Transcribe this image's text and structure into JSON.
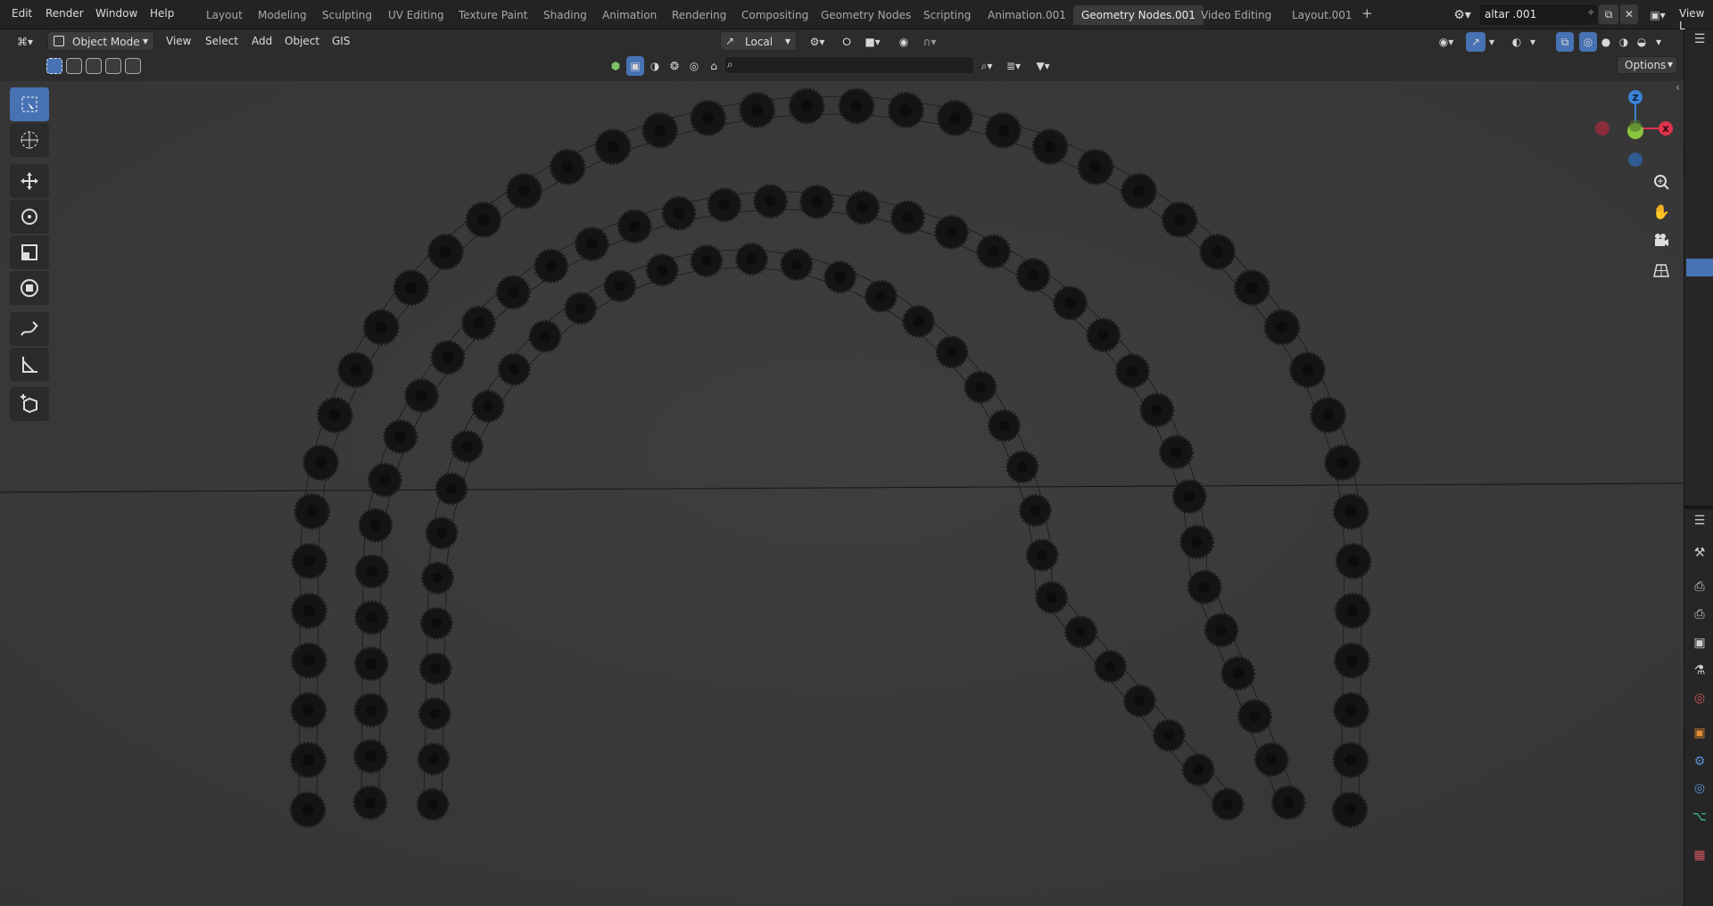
{
  "menu": [
    "Edit",
    "Render",
    "Window",
    "Help"
  ],
  "workspaces": [
    "Layout",
    "Modeling",
    "Sculpting",
    "UV Editing",
    "Texture Paint",
    "Shading",
    "Animation",
    "Rendering",
    "Compositing",
    "Geometry Nodes",
    "Scripting",
    "Animation.001",
    "Geometry Nodes.001",
    "Video Editing",
    "Layout.001"
  ],
  "active_workspace_index": 12,
  "add_workspace_glyph": "+",
  "scene_name": "altar .001",
  "view_layer_label": "View L",
  "header": {
    "mode": "Object Mode",
    "menus": [
      "View",
      "Select",
      "Add",
      "Object",
      "GIS"
    ],
    "transform_orientation": "Local",
    "options_label": "Options"
  },
  "search_placeholder": "",
  "gizmo": {
    "axes": [
      "Z",
      "X"
    ],
    "colors": {
      "x": "#e0344c",
      "y": "#8bc53f",
      "z": "#3b82d6"
    }
  },
  "tools": [
    "select-box-icon",
    "cursor-icon",
    "move-icon",
    "rotate-icon",
    "scale-icon",
    "transform-icon",
    "annotate-icon",
    "measure-icon",
    "add-cube-icon"
  ],
  "nav_controls": [
    "zoom-icon",
    "pan-hand-icon",
    "camera-icon",
    "grid-view-icon"
  ],
  "colors": {
    "accent": "#4772b3",
    "viewport_bg": "#3b3b3b",
    "arch_fill": "#141414"
  }
}
